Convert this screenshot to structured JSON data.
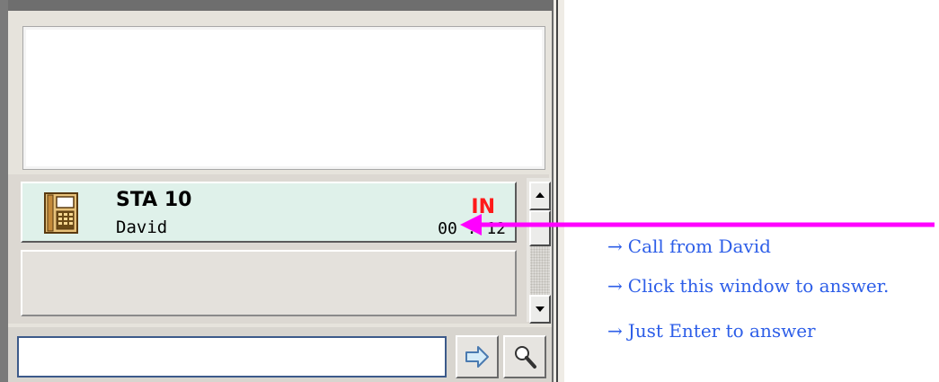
{
  "call": {
    "station": "STA 10",
    "caller": "David",
    "direction": "IN",
    "timer": "00 : 12"
  },
  "dial_input": {
    "value": ""
  },
  "annotations": {
    "arrow_glyph": "→",
    "lines": [
      "Call from David",
      "Click this window to answer.",
      "Just Enter to answer"
    ]
  },
  "icons": {
    "call_row": "desk-phone-icon",
    "go_button": "arrow-right-icon",
    "search_button": "magnifier-icon",
    "scroll_up": "triangle-up-icon",
    "scroll_down": "triangle-down-icon"
  },
  "colors": {
    "call_row_background": "#dff1ea",
    "direction_text": "#ff1a1a",
    "annotation_arrow": "#ff00ff",
    "annotation_text": "#2d5ee8"
  }
}
